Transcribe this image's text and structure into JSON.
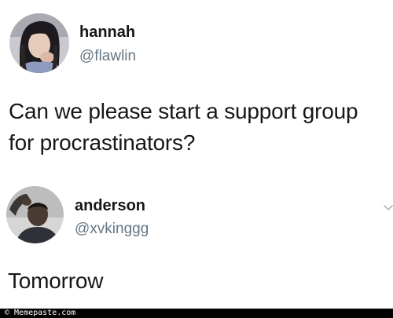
{
  "tweets": [
    {
      "display_name": "hannah",
      "handle": "@flawlin",
      "lines": [
        "Can we please start a support group",
        "for procrastinators?"
      ]
    },
    {
      "display_name": "anderson",
      "handle": "@xvkinggg",
      "text": "Tomorrow"
    }
  ],
  "icons": {
    "reply_menu": "chevron-down-icon"
  },
  "watermark": "© Memepaste.com",
  "colors": {
    "text": "#14171a",
    "handle": "#657786",
    "background": "#ffffff",
    "watermark_bar": "#000000"
  }
}
